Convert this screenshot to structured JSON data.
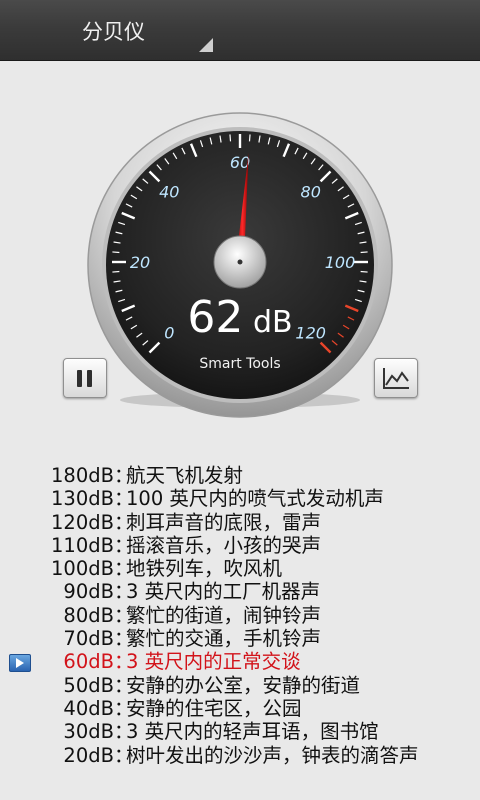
{
  "header": {
    "title": "分贝仪"
  },
  "meter": {
    "brand": "Smart Tools",
    "reading_value": "62",
    "reading_unit": "dB",
    "needle_level_db": 62,
    "scale_min": 0,
    "scale_max": 120,
    "scale_labels": [
      "0",
      "20",
      "40",
      "60",
      "80",
      "100",
      "120"
    ]
  },
  "buttons": {
    "pause": "pause-icon",
    "graph": "line-graph-icon"
  },
  "reference": {
    "selected_index": 8,
    "rows": [
      {
        "level": "180dB",
        "desc": "航天飞机发射"
      },
      {
        "level": "130dB",
        "desc": "100 英尺内的喷气式发动机声"
      },
      {
        "level": "120dB",
        "desc": "刺耳声音的底限，雷声"
      },
      {
        "level": "110dB",
        "desc": "摇滚音乐，小孩的哭声"
      },
      {
        "level": "100dB",
        "desc": "地铁列车，吹风机"
      },
      {
        "level": "90dB",
        "desc": "3 英尺内的工厂机器声"
      },
      {
        "level": "80dB",
        "desc": "繁忙的街道，闹钟铃声"
      },
      {
        "level": "70dB",
        "desc": "繁忙的交通，手机铃声"
      },
      {
        "level": "60dB",
        "desc": "3 英尺内的正常交谈"
      },
      {
        "level": "50dB",
        "desc": "安静的办公室，安静的街道"
      },
      {
        "level": "40dB",
        "desc": "安静的住宅区，公园"
      },
      {
        "level": "30dB",
        "desc": "3 英尺内的轻声耳语，图书馆"
      },
      {
        "level": "20dB",
        "desc": "树叶发出的沙沙声，钟表的滴答声"
      }
    ],
    "colors": {
      "active": "#d2131a",
      "normal": "#111111"
    }
  }
}
